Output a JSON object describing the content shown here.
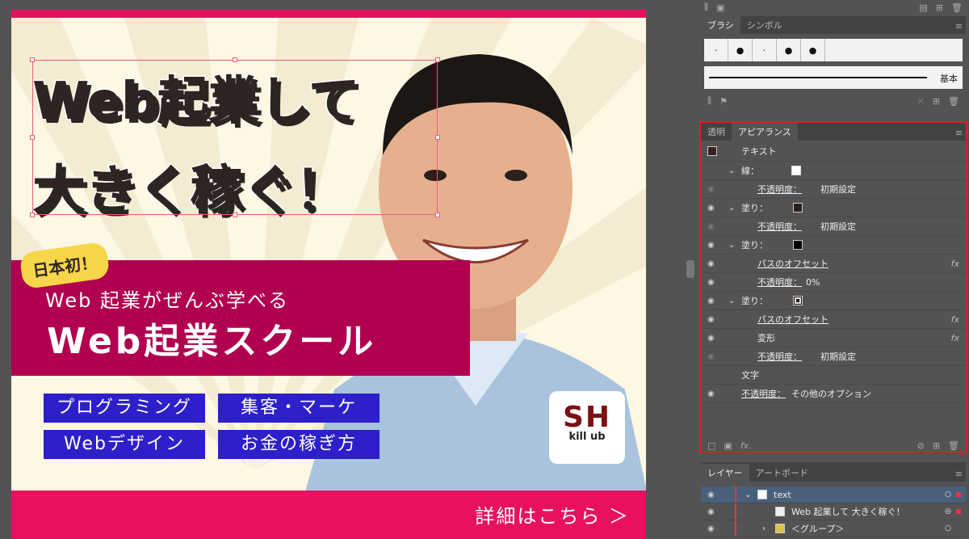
{
  "banner": {
    "headline_line1": "Web起業して",
    "headline_line2": "大きく稼ぐ！",
    "badge": "日本初！",
    "subtitle": "Web 起業がぜんぶ学べる",
    "title": "Web起業スクール",
    "chips": [
      "プログラミング",
      "集客・マーケ",
      "Webデザイン",
      "お金の稼ぎ方"
    ],
    "cta": "詳細はこちら ＞",
    "logo_main": "SH",
    "logo_sub": "kill ub",
    "colors": {
      "accent": "#e8115f",
      "band": "#b0004f",
      "chip": "#2d1fc9",
      "badge": "#f7d64a",
      "cream": "#fdf7e4"
    }
  },
  "brush_panel": {
    "tabs": [
      "ブラシ",
      "シンボル"
    ],
    "brushes": [
      "·",
      "●",
      "⋅",
      "●",
      "●"
    ],
    "basic_label": "基本"
  },
  "appearance_panel": {
    "tabs": [
      "透明",
      "アピアランス"
    ],
    "header": "テキスト",
    "rows": [
      {
        "type": "group",
        "label": "線："
      },
      {
        "type": "sub",
        "label": "不透明度：",
        "value": "初期設定"
      },
      {
        "type": "group",
        "label": "塗り："
      },
      {
        "type": "sub",
        "label": "不透明度：",
        "value": "初期設定"
      },
      {
        "type": "group",
        "label": "塗り："
      },
      {
        "type": "effect",
        "label": "パスのオフセット"
      },
      {
        "type": "sub",
        "label": "不透明度：",
        "value": "0%"
      },
      {
        "type": "group",
        "label": "塗り："
      },
      {
        "type": "effect",
        "label": "パスのオフセット"
      },
      {
        "type": "effect",
        "label": "変形"
      },
      {
        "type": "sub",
        "label": "不透明度：",
        "value": "初期設定"
      },
      {
        "type": "plain",
        "label": "文字"
      },
      {
        "type": "top",
        "label": "不透明度：",
        "value": "その他のオプション"
      }
    ]
  },
  "layers_panel": {
    "tabs": [
      "レイヤー",
      "アートボード"
    ],
    "rows": [
      {
        "label": "text"
      },
      {
        "label": "Web 起業して 大きく稼ぐ！"
      },
      {
        "label": "＜グループ＞"
      }
    ]
  }
}
